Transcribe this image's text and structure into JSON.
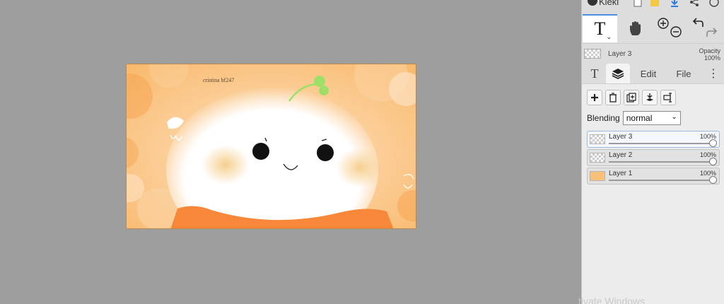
{
  "app": {
    "title": "Kleki"
  },
  "canvas": {
    "signature": "cristina hf247"
  },
  "toolbar": {
    "text_tool_glyph": "T",
    "text_tool_chevron": "⌄"
  },
  "layer_info": {
    "name": "Layer 3",
    "opacity_label": "Opacity",
    "opacity_value": "100%"
  },
  "tabs": [
    {
      "id": "text",
      "label": "T"
    },
    {
      "id": "layers",
      "label": ""
    },
    {
      "id": "edit",
      "label": "Edit"
    },
    {
      "id": "file",
      "label": "File"
    },
    {
      "id": "more",
      "label": "⋮"
    }
  ],
  "layers_panel": {
    "blending_label": "Blending",
    "blending_value": "normal",
    "layers": [
      {
        "name": "Layer 3",
        "opacity": "100%",
        "opacity_fraction": 1.0,
        "selected": true
      },
      {
        "name": "Layer 2",
        "opacity": "100%",
        "opacity_fraction": 1.0,
        "selected": false
      },
      {
        "name": "Layer 1",
        "opacity": "100%",
        "opacity_fraction": 1.0,
        "selected": false
      }
    ]
  },
  "watermark": "tivate Windows",
  "colors": {
    "accent": "#4a8fe0",
    "canvas_bg": "#f9c07a",
    "workspace": "#9e9e9e"
  }
}
